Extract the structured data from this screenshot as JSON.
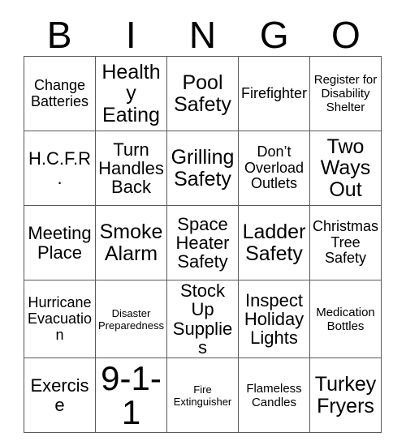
{
  "card": {
    "title_letters": [
      "B",
      "I",
      "N",
      "G",
      "O"
    ],
    "columns": 5,
    "rows": 5,
    "border_color": "#5a5a5a",
    "background_color": "#ffffff",
    "text_color": "#000000"
  },
  "cells": [
    [
      {
        "text": "Change Batteries",
        "size": "fs-sm"
      },
      {
        "text": "Healthy Eating",
        "size": "fs-lg"
      },
      {
        "text": "Pool Safety",
        "size": "fs-lg"
      },
      {
        "text": "Firefighter",
        "size": "fs-sm"
      },
      {
        "text": "Register for Disability Shelter",
        "size": "fs-xs"
      }
    ],
    [
      {
        "text": "H.C.F.R.",
        "size": "fs-md"
      },
      {
        "text": "Turn Handles Back",
        "size": "fs-md"
      },
      {
        "text": "Grilling Safety",
        "size": "fs-lg"
      },
      {
        "text": "Don’t Overload Outlets",
        "size": "fs-sm"
      },
      {
        "text": "Two Ways Out",
        "size": "fs-lg"
      }
    ],
    [
      {
        "text": "Meeting Place",
        "size": "fs-md"
      },
      {
        "text": "Smoke Alarm",
        "size": "fs-lg"
      },
      {
        "text": "Space Heater Safety",
        "size": "fs-md"
      },
      {
        "text": "Ladder Safety",
        "size": "fs-lg"
      },
      {
        "text": "Christmas Tree Safety",
        "size": "fs-sm"
      }
    ],
    [
      {
        "text": "Hurricane Evacuation",
        "size": "fs-sm"
      },
      {
        "text": "Disaster Preparedness",
        "size": "fs-xxs"
      },
      {
        "text": "Stock Up Supplies",
        "size": "fs-md"
      },
      {
        "text": "Inspect Holiday Lights",
        "size": "fs-md"
      },
      {
        "text": "Medication Bottles",
        "size": "fs-xs"
      }
    ],
    [
      {
        "text": "Exercise",
        "size": "fs-md"
      },
      {
        "text": "9-1-1",
        "size": "fs-xl"
      },
      {
        "text": "Fire Extinguisher",
        "size": "fs-xxs"
      },
      {
        "text": "Flameless Candles",
        "size": "fs-xs"
      },
      {
        "text": "Turkey Fryers",
        "size": "fs-lg"
      }
    ]
  ]
}
